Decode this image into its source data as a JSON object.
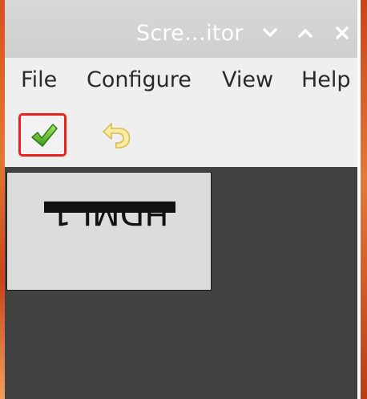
{
  "window": {
    "title": "Scre…itor"
  },
  "titlebar_buttons": [
    {
      "name": "minimize",
      "icon": "chevron-down-icon"
    },
    {
      "name": "maximize",
      "icon": "chevron-up-icon"
    },
    {
      "name": "close",
      "icon": "close-icon"
    }
  ],
  "menu": {
    "items": [
      "File",
      "Configure",
      "View",
      "Help"
    ]
  },
  "toolbar": {
    "apply_icon": "checkmark-icon",
    "undo_icon": "undo-icon",
    "highlight_color": "#e8231e"
  },
  "layout_canvas": {
    "background": "#424242",
    "monitors": [
      {
        "label": "HDMI-1",
        "orientation": "inverted"
      }
    ]
  }
}
